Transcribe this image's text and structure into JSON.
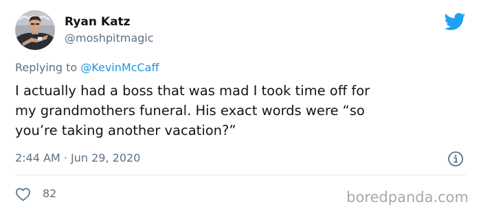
{
  "user": {
    "display_name": "Ryan Katz",
    "handle": "@moshpitmagic"
  },
  "reply": {
    "prefix": "Replying to ",
    "mention": "@KevinMcCaff"
  },
  "tweet": {
    "text": "I actually had a boss that was mad I took time off for\nmy grandmothers funeral. His exact words were “so\nyou’re taking another vacation?”",
    "timestamp": "2:44 AM · Jun 29, 2020",
    "like_count": "82"
  },
  "watermark": "boredpanda.com",
  "colors": {
    "twitter_blue": "#1da1f2",
    "mention_blue": "#1b95e0",
    "secondary_text": "#5b7083",
    "watermark_gray": "#a8a8a8"
  },
  "icons": {
    "brand": "twitter-bird-icon",
    "info": "info-icon",
    "like": "heart-icon"
  }
}
